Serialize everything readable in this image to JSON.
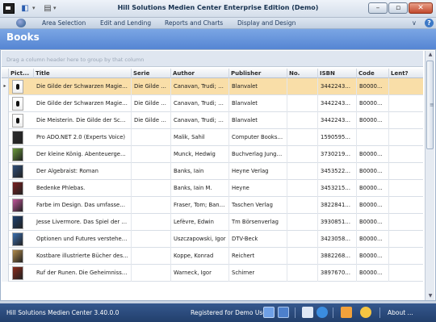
{
  "window": {
    "title": "Hill Solutions Medien Center Enterprise Edition (Demo)",
    "min_glyph": "–",
    "max_glyph": "▫",
    "close_glyph": "✕"
  },
  "menu": {
    "items": [
      "Area Selection",
      "Edit and Lending",
      "Reports and Charts",
      "Display and Design"
    ],
    "help_glyph": "?",
    "chevron_glyph": "∨"
  },
  "header": {
    "title": "Books"
  },
  "grid": {
    "group_hint": "Drag a column header here to group by that column",
    "columns": [
      "Pict...",
      "Title",
      "Serie",
      "Author",
      "Publisher",
      "No.",
      "ISBN",
      "Code",
      "Lent?"
    ],
    "rows": [
      {
        "title": "Die Gilde der Schwarzen Magier 02. ...",
        "serie": "Die Gilde de...",
        "author": "Canavan, Trudi; Lin...",
        "publisher": "Blanvalet",
        "no": "",
        "isbn": "3442243955",
        "code": "B000000...",
        "lent": "",
        "cover": "blank"
      },
      {
        "title": "Die Gilde der Schwarzen Magier 01. ...",
        "serie": "Die Gilde de...",
        "author": "Canavan, Trudi; Lin...",
        "publisher": "Blanvalet",
        "no": "",
        "isbn": "3442243947",
        "code": "B000000...",
        "lent": "",
        "cover": "blank"
      },
      {
        "title": "Die Meisterin. Die Gilde der Schwarz...",
        "serie": "Die Gilde de...",
        "author": "Canavan, Trudi; Lin...",
        "publisher": "Blanvalet",
        "no": "",
        "isbn": "3442243963",
        "code": "B000000...",
        "lent": "",
        "cover": "blank"
      },
      {
        "title": "Pro ADO.NET 2.0 (Experts Voice)",
        "serie": "",
        "author": "Malik, Sahil",
        "publisher": "Computer Bookshops",
        "no": "",
        "isbn": "1590595122",
        "code": "",
        "lent": "",
        "cover": "#2b2b2b"
      },
      {
        "title": "Der kleine König. Abenteuergeschich...",
        "serie": "",
        "author": "Munck, Hedwig",
        "publisher": "Buchverlag Junge ...",
        "no": "",
        "isbn": "3730219464",
        "code": "B000000...",
        "lent": "",
        "cover": "#6a9a3a"
      },
      {
        "title": "Der Algebraist: Roman",
        "serie": "",
        "author": "Banks, Iain",
        "publisher": "Heyne Verlag",
        "no": "",
        "isbn": "345352201X",
        "code": "B000000...",
        "lent": "",
        "cover": "#2f4f7a"
      },
      {
        "title": "Bedenke Phlebas.",
        "serie": "",
        "author": "Banks, Iain M.",
        "publisher": "Heyne",
        "no": "",
        "isbn": "3453215303",
        "code": "B000000...",
        "lent": "",
        "cover": "#7a1f1f"
      },
      {
        "title": "Farbe im Design. Das umfassende K...",
        "serie": "",
        "author": "Fraser, Tom; Banks,...",
        "publisher": "Taschen Verlag",
        "no": "",
        "isbn": "3822841668",
        "code": "B000000...",
        "lent": "",
        "cover": "#c0569a"
      },
      {
        "title": "Jesse Livermore. Das Spiel der Spiel...",
        "serie": "",
        "author": "Lefèvre, Edwin",
        "publisher": "Tm Börsenverlag",
        "no": "",
        "isbn": "3930851040",
        "code": "B000000...",
        "lent": "",
        "cover": "#1c3f6e"
      },
      {
        "title": "Optionen und Futures verstehen. Gr...",
        "serie": "",
        "author": "Uszczapowski, Igor",
        "publisher": "DTV-Beck",
        "no": "",
        "isbn": "3423058080",
        "code": "B000000...",
        "lent": "",
        "cover": "#3a6fb0"
      },
      {
        "title": "Kostbare illustrierte Bücher des sech...",
        "serie": "",
        "author": "Koppe, Konrad",
        "publisher": "Reichert",
        "no": "",
        "isbn": "3882268298",
        "code": "B000000...",
        "lent": "",
        "cover": "#b08a4a"
      },
      {
        "title": "Ruf der Runen. Die Geheimnisse der...",
        "serie": "",
        "author": "Warneck, Igor",
        "publisher": "Schirner",
        "no": "",
        "isbn": "3897670860",
        "code": "B000000...",
        "lent": "",
        "cover": "#8a2a1a"
      }
    ]
  },
  "status": {
    "version": "Hill Solutions Medien Center 3.40.0.0",
    "registered": "Registered for Demo User",
    "about": "About ..."
  },
  "colors": {
    "accent": "#5585d3",
    "selected_row": "#f9dea8",
    "status_bg": "#2a4a7c"
  }
}
